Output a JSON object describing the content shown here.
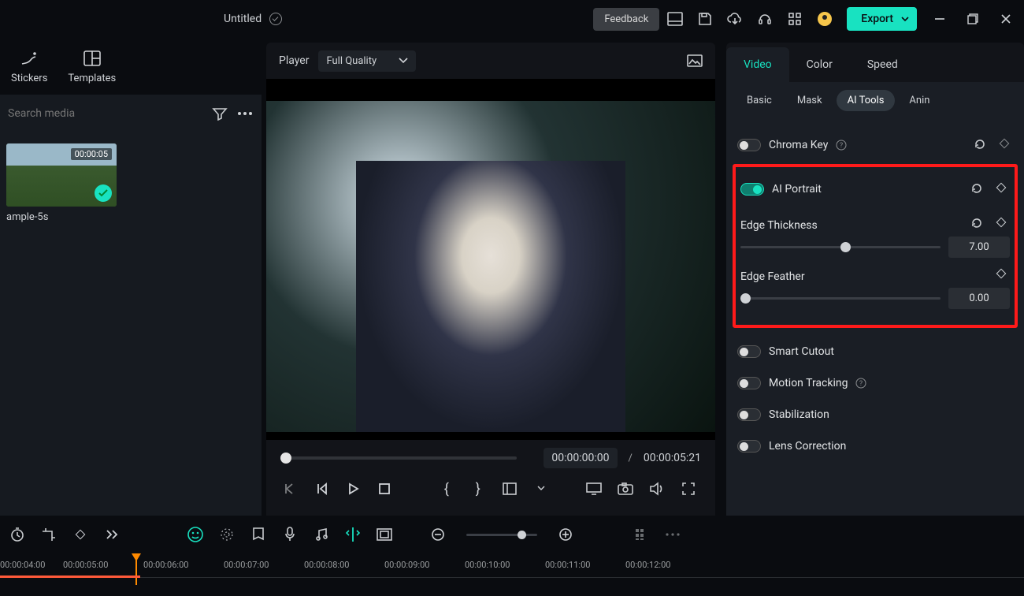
{
  "header": {
    "title": "Untitled",
    "feedback_label": "Feedback",
    "export_label": "Export"
  },
  "left": {
    "tabs": [
      {
        "label": "Stickers"
      },
      {
        "label": "Templates"
      }
    ],
    "search_placeholder": "Search media",
    "clip": {
      "duration": "00:00:05",
      "label": "ample-5s"
    }
  },
  "player": {
    "label": "Player",
    "quality": "Full Quality",
    "current_time": "00:00:00:00",
    "separator": "/",
    "total_time": "00:00:05:21"
  },
  "right": {
    "tabs": [
      "Video",
      "Color",
      "Speed"
    ],
    "subtabs": [
      "Basic",
      "Mask",
      "AI Tools",
      "Anin"
    ],
    "chroma_key": "Chroma Key",
    "ai_portrait": "AI Portrait",
    "edge_thickness": {
      "label": "Edge Thickness",
      "value": "7.00"
    },
    "edge_feather": {
      "label": "Edge Feather",
      "value": "0.00"
    },
    "smart_cutout": "Smart Cutout",
    "motion_tracking": "Motion Tracking",
    "stabilization": "Stabilization",
    "lens_correction": "Lens Correction"
  },
  "timeline": {
    "ticks": [
      "00:00:04:00",
      "00:00:05:00",
      "00:00:06:00",
      "00:00:07:00",
      "00:00:08:00",
      "00:00:09:00",
      "00:00:10:00",
      "00:00:11:00",
      "00:00:12:00"
    ]
  }
}
